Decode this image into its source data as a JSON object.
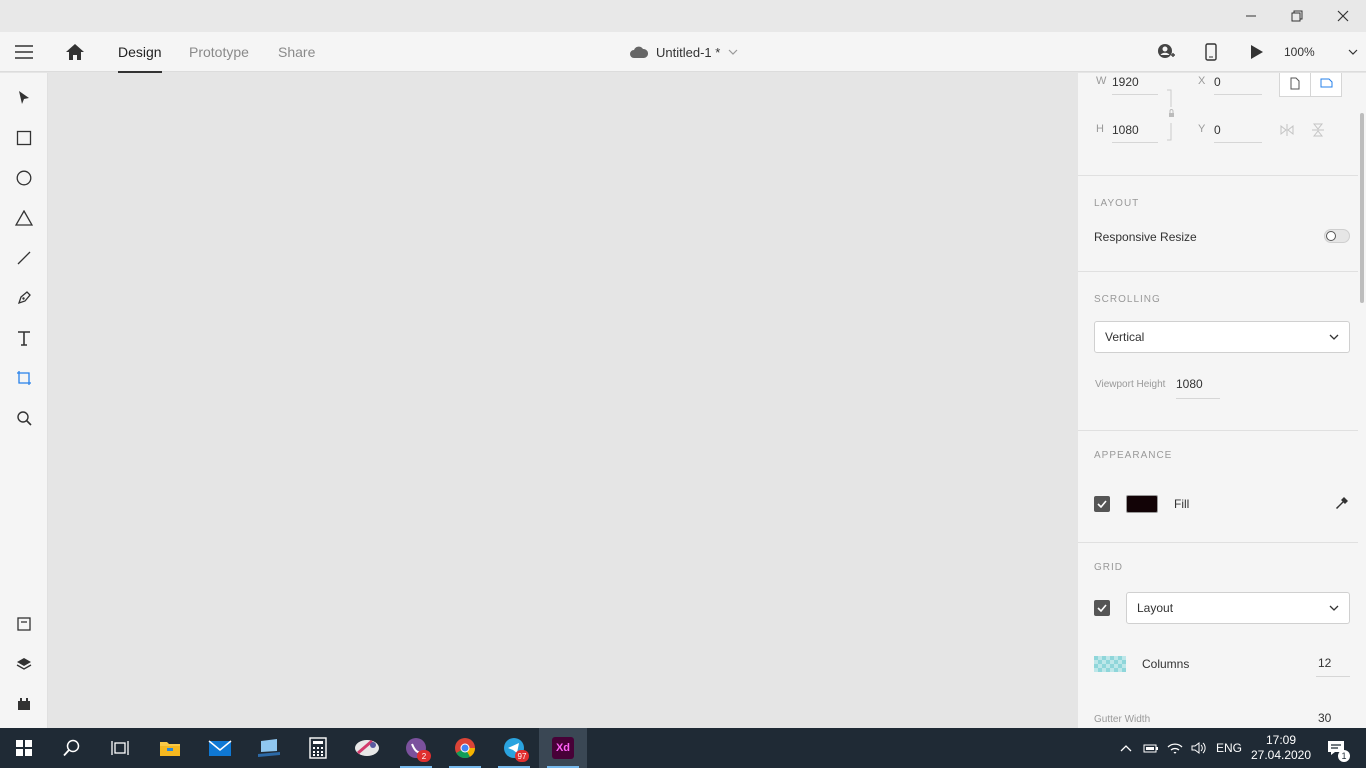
{
  "window": {
    "minimize": "minimize",
    "restore": "restore",
    "close": "close"
  },
  "topbar": {
    "tabs": [
      {
        "label": "Design",
        "active": true
      },
      {
        "label": "Prototype",
        "active": false
      },
      {
        "label": "Share",
        "active": false
      }
    ],
    "document_title": "Untitled-1 *",
    "zoom": "100%"
  },
  "panel": {
    "size": {
      "w_label": "W",
      "w": "1920",
      "h_label": "H",
      "h": "1080",
      "x_label": "X",
      "x": "0",
      "y_label": "Y",
      "y": "0"
    },
    "layout": {
      "heading": "LAYOUT",
      "responsive_resize": "Responsive Resize",
      "responsive_on": false
    },
    "scrolling": {
      "heading": "SCROLLING",
      "mode": "Vertical",
      "viewport_height_label": "Viewport Height",
      "viewport_height": "1080"
    },
    "appearance": {
      "heading": "APPEARANCE",
      "fill_label": "Fill",
      "fill_color": "#120306",
      "fill_checked": true
    },
    "grid": {
      "heading": "GRID",
      "type": "Layout",
      "columns_label": "Columns",
      "columns": "12",
      "gutter_label": "Gutter Width",
      "gutter": "30"
    }
  },
  "taskbar": {
    "apps": [
      {
        "name": "task-view",
        "running": false
      },
      {
        "name": "file-explorer",
        "running": false
      },
      {
        "name": "mail",
        "running": false
      },
      {
        "name": "desktop-app",
        "running": false
      },
      {
        "name": "calculator",
        "running": false
      },
      {
        "name": "snip-tool",
        "running": false
      },
      {
        "name": "viber",
        "running": true,
        "badge": "2"
      },
      {
        "name": "chrome",
        "running": true
      },
      {
        "name": "telegram",
        "running": true,
        "badge": "97"
      },
      {
        "name": "adobe-xd",
        "running": true,
        "label": "Xd"
      }
    ],
    "language": "ENG",
    "time": "17:09",
    "date": "27.04.2020",
    "notifications": "1"
  },
  "colors": {
    "accent": "#2680eb",
    "xd": "#470137",
    "xd_text": "#ff61f6"
  }
}
